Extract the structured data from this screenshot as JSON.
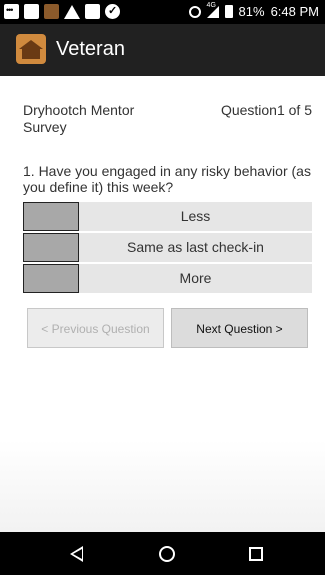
{
  "status_bar": {
    "network_label": "4G",
    "battery": "81%",
    "time": "6:48 PM",
    "icons": [
      "message-icon",
      "image-icon",
      "app-icon",
      "drive-icon",
      "photo-icon",
      "check-icon",
      "alarm-icon",
      "signal-icon",
      "battery-icon"
    ]
  },
  "app_bar": {
    "title": "Veteran",
    "logo_icon": "house-logo-icon",
    "background": "#212121"
  },
  "survey": {
    "name": "Dryhootch Mentor Survey",
    "counter": "Question1 of 5",
    "question": "1. Have you engaged in any risky behavior (as you define it) this week?",
    "options": [
      {
        "label": "Less"
      },
      {
        "label": "Same as last check-in"
      },
      {
        "label": "More"
      }
    ]
  },
  "buttons": {
    "previous": "< Previous Question",
    "next": "Next Question >"
  },
  "nav_bar": {
    "icons": [
      "back-icon",
      "home-icon",
      "recents-icon"
    ]
  }
}
